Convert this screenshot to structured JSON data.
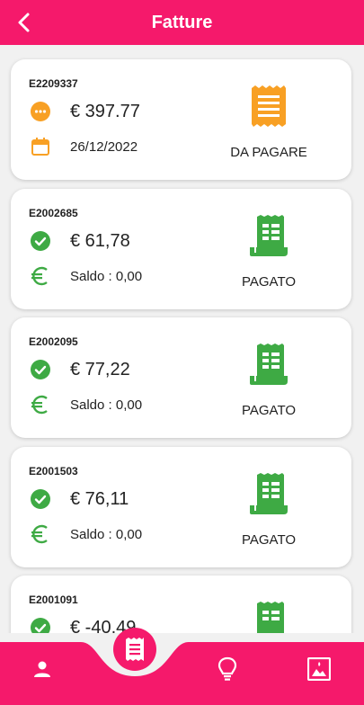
{
  "header": {
    "title": "Fatture"
  },
  "invoices": [
    {
      "code": "E2209337",
      "amount": "€ 397.77",
      "detail": "26/12/2022",
      "status": "DA PAGARE"
    },
    {
      "code": "E2002685",
      "amount": "€ 61,78",
      "detail": "Saldo : 0,00",
      "status": "PAGATO"
    },
    {
      "code": "E2002095",
      "amount": "€ 77,22",
      "detail": "Saldo : 0,00",
      "status": "PAGATO"
    },
    {
      "code": "E2001503",
      "amount": "€ 76,11",
      "detail": "Saldo : 0,00",
      "status": "PAGATO"
    },
    {
      "code": "E2001091",
      "amount": "€ -40,49",
      "detail": "",
      "status": ""
    }
  ],
  "colors": {
    "brand": "#f5196b",
    "pending": "#f8a024",
    "paid": "#3eaa44"
  },
  "icons": {
    "back": "back-arrow-icon",
    "pending_status": "more-horizontal-icon",
    "date": "calendar-icon",
    "paid_status": "check-circle-icon",
    "euro": "euro-icon",
    "receipt": "receipt-icon",
    "nav_profile": "person-icon",
    "nav_invoices": "receipt-icon",
    "nav_tips": "lightbulb-icon",
    "nav_gallery": "photo-icon"
  }
}
